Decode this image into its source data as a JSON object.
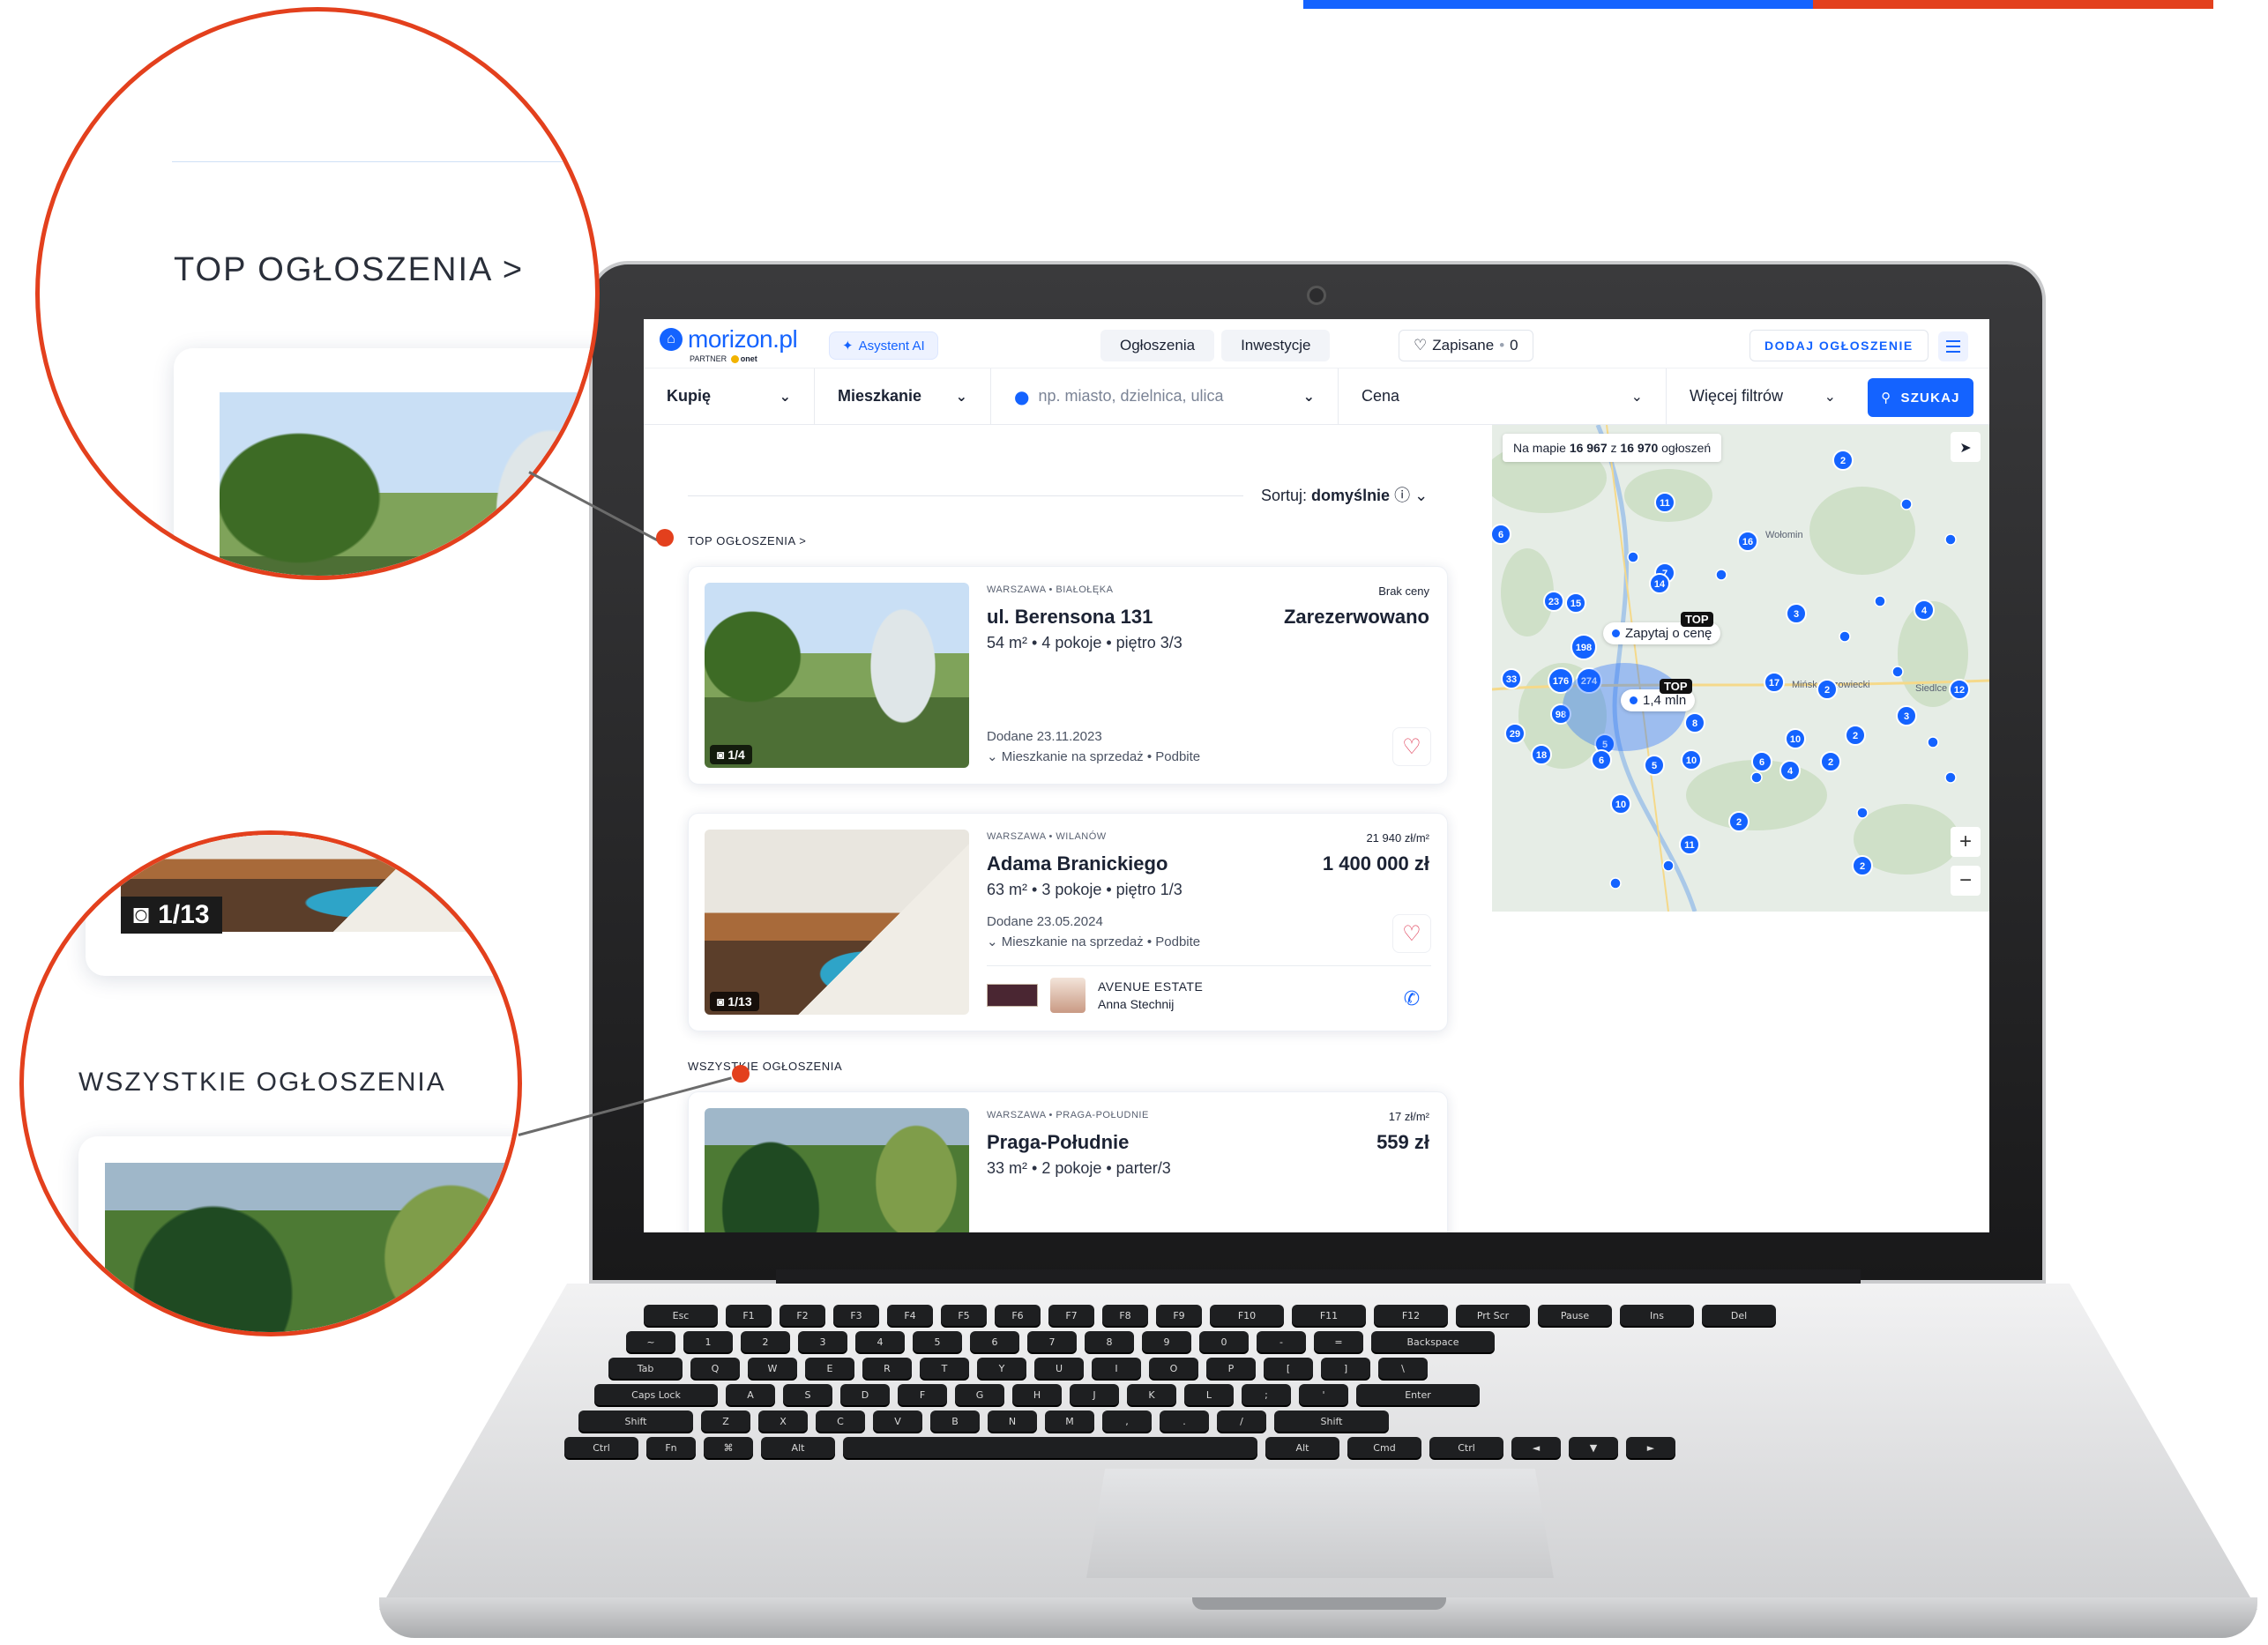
{
  "header": {
    "logo_text": "morizon.pl",
    "logo_partner": "PARTNER",
    "logo_partner_brand": "onet",
    "ai_label": "Asystent AI",
    "nav": [
      "Ogłoszenia",
      "Inwestycje"
    ],
    "saved_label": "Zapisane",
    "saved_count": "0",
    "add_listing": "DODAJ OGŁOSZENIE"
  },
  "filters": {
    "transaction": "Kupię",
    "property_type": "Mieszkanie",
    "location_placeholder": "np. miasto, dzielnica, ulica",
    "price": "Cena",
    "more_filters": "Więcej filtrów",
    "search": "SZUKAJ"
  },
  "sort": {
    "label": "Sortuj:",
    "value": "domyślnie"
  },
  "sections": {
    "top": "TOP OGŁOSZENIA >",
    "all": "WSZYSTKIE OGŁOSZENIA"
  },
  "listings": [
    {
      "location": "WARSZAWA • BIAŁOŁĘKA",
      "extra": "Brak ceny",
      "title": "ul. Berensona 131",
      "price": "Zarezerwowano",
      "details": "54 m² • 4 pokoje • piętro 3/3",
      "added": "Dodane 23.11.2023",
      "type": "Mieszkanie na sprzedaż • Podbite",
      "photo_count": "1/4"
    },
    {
      "location": "WARSZAWA • WILANÓW",
      "extra": "21 940 zł/m²",
      "title": "Adama Branickiego",
      "price": "1 400 000 zł",
      "details": "63 m² • 3 pokoje • piętro 1/3",
      "added": "Dodane 23.05.2024",
      "type": "Mieszkanie na sprzedaż • Podbite",
      "photo_count": "1/13",
      "agency": "AVENUE ESTATE",
      "agent": "Anna Stechnij"
    },
    {
      "location": "WARSZAWA • PRAGA-POŁUDNIE",
      "extra": "17 zł/m²",
      "title": "Praga-Południe",
      "price": "559 zł",
      "details": "33 m² • 2 pokoje • parter/3"
    }
  ],
  "map": {
    "badge_prefix": "Na mapie",
    "badge_shown": "16 967",
    "badge_mid": "z",
    "badge_total": "16 970",
    "badge_suffix": "ogłoszeń",
    "tooltip_ask": "Zapytaj o cenę",
    "tooltip_price": "1,4 mln",
    "top_tag": "TOP",
    "labels": [
      "Wołomin",
      "Mińsk Mazowiecki",
      "Siedlce"
    ],
    "clusters": [
      "2",
      "11",
      "6",
      "16",
      "7",
      "14",
      "23",
      "15",
      "3",
      "4",
      "198",
      "33",
      "274",
      "176",
      "98",
      "5",
      "29",
      "18",
      "6",
      "10",
      "17",
      "2",
      "10",
      "2",
      "4",
      "2",
      "10",
      "11",
      "6",
      "12",
      "5",
      "8",
      "3",
      "2",
      "2"
    ]
  },
  "zoom": {
    "top_label": "TOP OGŁOSZENIA >",
    "photo_count": "1/13",
    "all_label": "WSZYSTKIE OGŁOSZENIA"
  },
  "colors": {
    "brand": "#1463ff",
    "accent_red": "#e3401d"
  },
  "keyboard": {
    "row1": [
      "Esc",
      "F1",
      "F2",
      "F3",
      "F4",
      "F5",
      "F6",
      "F7",
      "F8",
      "F9",
      "F10",
      "F11",
      "F12",
      "Prt Scr",
      "Pause",
      "Ins",
      "Del"
    ],
    "row2": [
      "~",
      "1",
      "2",
      "3",
      "4",
      "5",
      "6",
      "7",
      "8",
      "9",
      "0",
      "-",
      "=",
      "Backspace"
    ],
    "row3": [
      "Tab",
      "Q",
      "W",
      "E",
      "R",
      "T",
      "Y",
      "U",
      "I",
      "O",
      "P",
      "[",
      "]",
      "\\"
    ],
    "row4": [
      "Caps Lock",
      "A",
      "S",
      "D",
      "F",
      "G",
      "H",
      "J",
      "K",
      "L",
      ";",
      "'",
      "Enter"
    ],
    "row5": [
      "Shift",
      "Z",
      "X",
      "C",
      "V",
      "B",
      "N",
      "M",
      ",",
      ".",
      "/",
      "Shift"
    ],
    "row6": [
      "Ctrl",
      "Fn",
      "⌘",
      "Alt",
      "",
      "Alt",
      "Cmd",
      "Ctrl",
      "◄",
      "▼",
      "►"
    ]
  }
}
